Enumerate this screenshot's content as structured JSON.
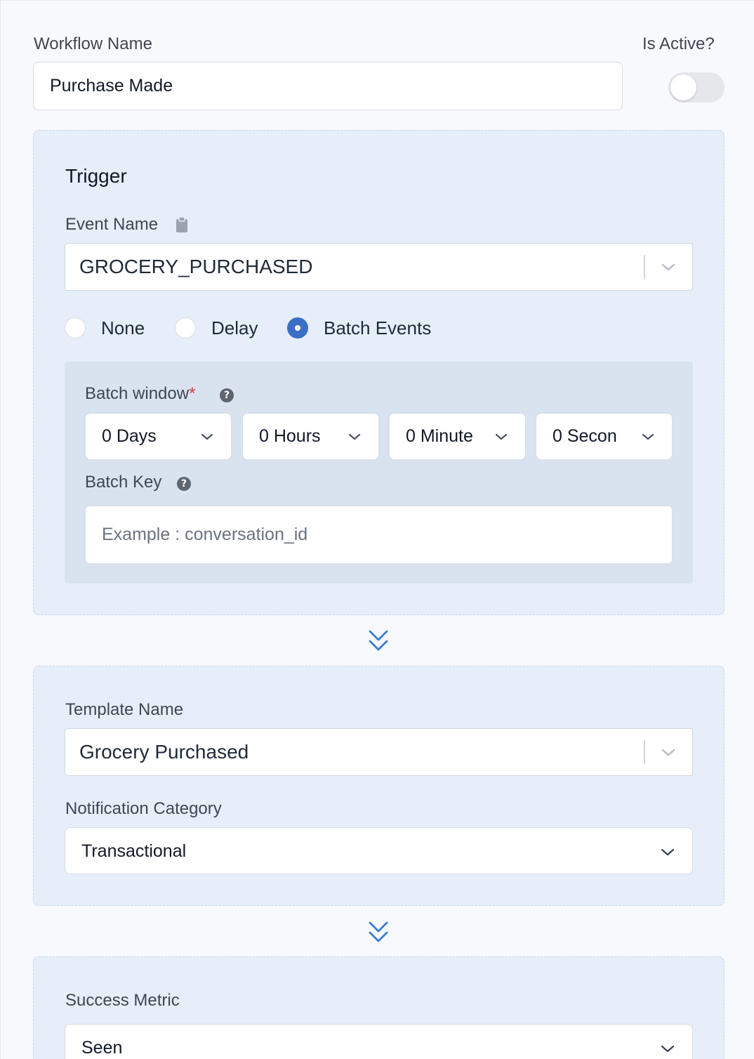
{
  "workflow": {
    "name_label": "Workflow Name",
    "name_value": "Purchase Made",
    "active_label": "Is Active?",
    "active": false
  },
  "trigger": {
    "title": "Trigger",
    "event_name_label": "Event Name",
    "event_name_value": "GROCERY_PURCHASED",
    "options": [
      {
        "label": "None",
        "selected": false
      },
      {
        "label": "Delay",
        "selected": false
      },
      {
        "label": "Batch Events",
        "selected": true
      }
    ],
    "batch_window_label": "Batch window",
    "batch_window_required": "*",
    "batch_window": {
      "days": "0 Days",
      "hours": "0 Hours",
      "minutes": "0 Minute",
      "seconds": "0 Secon"
    },
    "batch_key_label": "Batch Key",
    "batch_key_placeholder": "Example : conversation_id",
    "help_glyph": "?"
  },
  "template": {
    "template_name_label": "Template Name",
    "template_name_value": "Grocery Purchased",
    "category_label": "Notification Category",
    "category_value": "Transactional"
  },
  "success": {
    "metric_label": "Success Metric",
    "metric_value": "Seen"
  },
  "colors": {
    "accent": "#3a6fc4",
    "card_bg": "#e6eef9",
    "batch_bg": "#d9e3ef",
    "required": "#e0393e"
  }
}
